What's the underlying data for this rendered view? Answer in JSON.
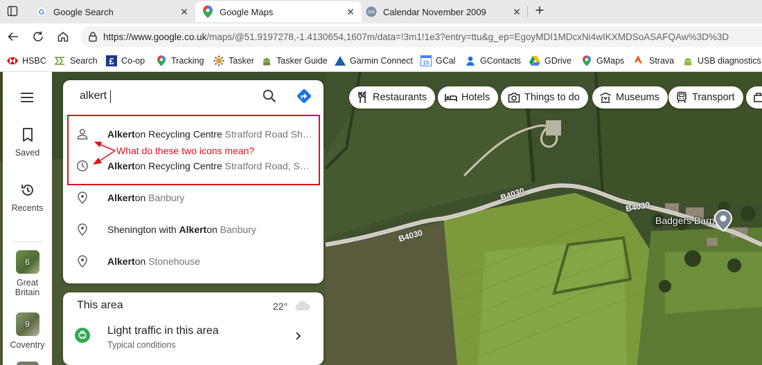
{
  "browser": {
    "tabs": [
      {
        "title": "Google Search",
        "favicon": "google-g-icon",
        "active": false
      },
      {
        "title": "Google Maps",
        "favicon": "maps-pin-icon",
        "active": true
      },
      {
        "title": "Calendar November 2009",
        "favicon": "calendar-365-icon",
        "active": false
      }
    ],
    "new_tab_label": "+",
    "url_host": "https://www.google.co.uk",
    "url_path": "/maps/@51.9197278,-1.4130654,1607m/data=!3m1!1e3?entry=ttu&g_ep=EgoyMDI1MDcxNi4wIKXMDSoASAFQAw%3D%3D",
    "bookmarks": [
      {
        "label": "HSBC",
        "icon": "hsbc-icon"
      },
      {
        "label": "Search",
        "icon": "search-bookmark-icon"
      },
      {
        "label": "Co-op",
        "icon": "coop-icon"
      },
      {
        "label": "Tracking",
        "icon": "maps-pin-icon"
      },
      {
        "label": "Tasker",
        "icon": "tasker-icon"
      },
      {
        "label": "Tasker Guide",
        "icon": "android-icon"
      },
      {
        "label": "Garmin Connect",
        "icon": "garmin-icon"
      },
      {
        "label": "GCal",
        "icon": "gcal-icon"
      },
      {
        "label": "GContacts",
        "icon": "contacts-icon"
      },
      {
        "label": "GDrive",
        "icon": "drive-icon"
      },
      {
        "label": "GMaps",
        "icon": "maps-pin-icon"
      },
      {
        "label": "Strava",
        "icon": "strava-icon"
      },
      {
        "label": "USB diagnostics",
        "icon": "android-icon"
      }
    ]
  },
  "rail": {
    "saved_label": "Saved",
    "recents_label": "Recents",
    "recent_places": [
      {
        "label_line1": "Great",
        "label_line2": "Britain",
        "badge": "6"
      },
      {
        "label_line1": "Coventry",
        "label_line2": "",
        "badge": "9"
      }
    ]
  },
  "search": {
    "query": "alkert",
    "suggestions": [
      {
        "icon": "person-icon",
        "bold": "Alkert",
        "rest": "on Recycling Centre",
        "sub": " Stratford Road Sh…"
      },
      {
        "icon": "history-icon",
        "bold": "Alkert",
        "rest": "on Recycling Centre",
        "sub": " Stratford Road, S…"
      },
      {
        "icon": "place-pin-icon",
        "bold": "Alkert",
        "rest": "on",
        "sub": " Banbury"
      },
      {
        "icon": "place-pin-icon",
        "pre": "Shenington with ",
        "bold": "Alkert",
        "rest": "on",
        "sub": " Banbury"
      },
      {
        "icon": "place-pin-icon",
        "bold": "Alkert",
        "rest": "on",
        "sub": " Stonehouse"
      }
    ]
  },
  "annotation": {
    "text": "What do these two icons mean?",
    "color": "#e0101a"
  },
  "chips": [
    {
      "label": "Restaurants",
      "icon": "restaurant-icon"
    },
    {
      "label": "Hotels",
      "icon": "hotel-icon"
    },
    {
      "label": "Things to do",
      "icon": "camera-icon"
    },
    {
      "label": "Museums",
      "icon": "museum-icon"
    },
    {
      "label": "Transport",
      "icon": "transport-icon"
    }
  ],
  "area": {
    "title": "This area",
    "temperature": "22°",
    "traffic_title": "Light traffic in this area",
    "traffic_sub": "Typical conditions"
  },
  "map_labels": {
    "road_1": "B4030",
    "road_2": "B4030",
    "road_3": "B4030",
    "place": "Badgers Barn"
  }
}
